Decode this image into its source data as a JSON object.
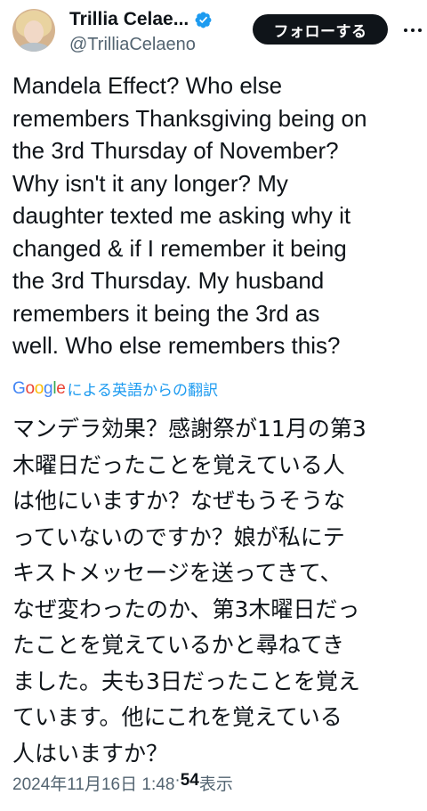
{
  "author": {
    "display_name": "Trillia Celae...",
    "handle": "@TrilliaCelaeno",
    "verified": true
  },
  "actions": {
    "follow_label": "フォローする",
    "more_icon": "more-icon"
  },
  "tweet": {
    "lines": [
      "Mandela Effect? Who else",
      "remembers Thanksgiving being on",
      "the 3rd Thursday of November?",
      "Why isn't it any longer? My",
      "daughter texted me asking why it",
      "changed & if I remember it being",
      "the 3rd Thursday.  My husband",
      "remembers it being the 3rd as",
      "well. Who else remembers this?"
    ]
  },
  "translation": {
    "provider": "Google",
    "link_label": "による英語からの翻訳",
    "lines": [
      "マンデラ効果？感謝祭が11月の第3",
      "木曜日だったことを覚えている人",
      "は他にいますか？なぜもうそうな",
      "っていないのですか？娘が私にテ",
      "キストメッセージを送ってきて、",
      "なぜ変わったのか、第3木曜日だっ",
      "たことを覚えているかと尋ねてき",
      "ました。夫も3日だったことを覚え",
      "ています。他にこれを覚えている",
      "人はいますか？"
    ]
  },
  "meta": {
    "timestamp": "2024年11月16日 1:48",
    "separator": " · ",
    "views_count": "54",
    "views_label": " 表示"
  },
  "colors": {
    "accent": "#1d9bf0",
    "text": "#0f1419",
    "secondary": "#536471"
  }
}
